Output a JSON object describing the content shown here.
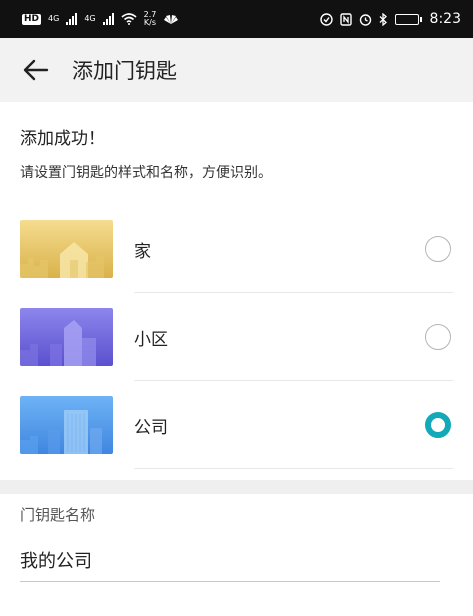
{
  "status_bar": {
    "hd": "HD",
    "net1": "4G",
    "net2": "4G",
    "speed_value": "2.7",
    "speed_unit": "K/s",
    "time": "8:23",
    "battery_level": 0.22,
    "battery_color": "#f5a623"
  },
  "header": {
    "title": "添加门钥匙",
    "back_icon": "arrow-left-icon"
  },
  "content": {
    "success_title": "添加成功！",
    "hint": "请设置门钥匙的样式和名称，方便识别。",
    "styles": [
      {
        "label": "家",
        "theme": "yellow",
        "checked": false
      },
      {
        "label": "小区",
        "theme": "purple",
        "checked": false
      },
      {
        "label": "公司",
        "theme": "blue",
        "checked": true
      }
    ],
    "accent_color": "#13a9b8"
  },
  "name_section": {
    "label": "门钥匙名称",
    "value": "我的公司"
  }
}
